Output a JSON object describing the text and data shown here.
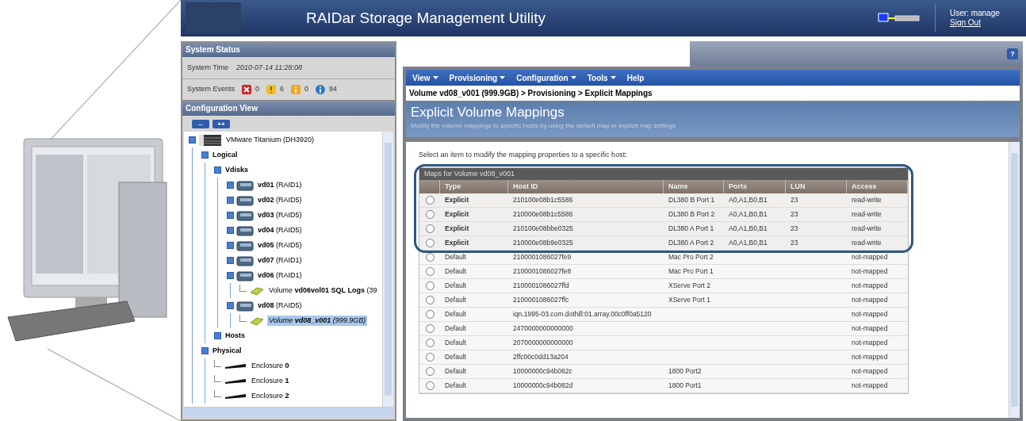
{
  "header": {
    "title": "RAIDar Storage Management Utility",
    "user": "User: manage",
    "sign_out": "Sign Out"
  },
  "system_status": {
    "title": "System Status",
    "time_label": "System Time",
    "time_value": "2010-07-14 11:28:08",
    "events_label": "System Events",
    "events": [
      {
        "kind": "critical",
        "count": "0"
      },
      {
        "kind": "error",
        "count": "6"
      },
      {
        "kind": "warning",
        "count": "0"
      },
      {
        "kind": "info",
        "count": "94"
      }
    ]
  },
  "configuration_view": {
    "title": "Configuration View",
    "buttons": [
      "--",
      "++"
    ],
    "tree": [
      {
        "label": "VMware Titanium (DH3920)",
        "kind": "system",
        "selected": false,
        "children": [
          {
            "label": "Logical",
            "kind": "group",
            "selected": false,
            "children": [
              {
                "label": "Vdisks",
                "kind": "group",
                "selected": false,
                "children": [
                  {
                    "label": "**vd01** (RAID1)",
                    "kind": "vdisk",
                    "selected": false
                  },
                  {
                    "label": "**vd02** (RAID5)",
                    "kind": "vdisk",
                    "selected": false
                  },
                  {
                    "label": "**vd03** (RAID5)",
                    "kind": "vdisk",
                    "selected": false
                  },
                  {
                    "label": "**vd04** (RAID5)",
                    "kind": "vdisk",
                    "selected": false
                  },
                  {
                    "label": "**vd05** (RAID5)",
                    "kind": "vdisk",
                    "selected": false
                  },
                  {
                    "label": "**vd07** (RAID1)",
                    "kind": "vdisk",
                    "selected": false
                  },
                  {
                    "label": "**vd06** (RAID1)",
                    "kind": "vdisk",
                    "selected": false,
                    "children": [
                      {
                        "label": "Volume **vd06vol01 SQL Logs** (39",
                        "kind": "volume",
                        "selected": false
                      }
                    ]
                  },
                  {
                    "label": "**vd08** (RAID5)",
                    "kind": "vdisk",
                    "selected": false,
                    "children": [
                      {
                        "label": "Volume **vd08_v001** *(999.9GB)*",
                        "kind": "volume",
                        "selected": true
                      }
                    ]
                  }
                ]
              },
              {
                "label": "Hosts",
                "kind": "group",
                "selected": false
              }
            ]
          },
          {
            "label": "Physical",
            "kind": "group",
            "selected": false,
            "children": [
              {
                "label": "Enclosure **0**",
                "kind": "enclosure",
                "selected": false
              },
              {
                "label": "Enclosure **1**",
                "kind": "enclosure",
                "selected": false
              },
              {
                "label": "Enclosure **2**",
                "kind": "enclosure",
                "selected": false
              }
            ]
          }
        ]
      }
    ]
  },
  "menu": [
    {
      "label": "View",
      "dropdown": true
    },
    {
      "label": "Provisioning",
      "dropdown": true
    },
    {
      "label": "Configuration",
      "dropdown": true
    },
    {
      "label": "Tools",
      "dropdown": true
    },
    {
      "label": "Help",
      "dropdown": false
    }
  ],
  "help_button": "?",
  "breadcrumb": "Volume vd08_v001 (999.9GB) > Provisioning > Explicit Mappings",
  "page": {
    "title": "Explicit Volume Mappings",
    "subtitle": "Modify the volume mappings to specific hosts by using the default map or explicit map settings",
    "instruction": "Select an item to modify the mapping properties to a specific host:"
  },
  "table": {
    "caption": "Maps for Volume vd08_v001",
    "columns": [
      "Type",
      "Host ID",
      "Name",
      "Ports",
      "LUN",
      "Access"
    ],
    "rows": [
      {
        "selected": false,
        "highlighted": true,
        "cells": [
          "Explicit",
          "210100e08b1c5586",
          "DL380 B Port 1",
          "A0,A1,B0,B1",
          "23",
          "read-write"
        ]
      },
      {
        "selected": false,
        "highlighted": true,
        "cells": [
          "Explicit",
          "210000e08b1c5586",
          "DL380 B Port 2",
          "A0,A1,B0,B1",
          "23",
          "read-write"
        ]
      },
      {
        "selected": false,
        "highlighted": true,
        "cells": [
          "Explicit",
          "210100e08bbe0325",
          "DL380 A Port 1",
          "A0,A1,B0,B1",
          "23",
          "read-write"
        ]
      },
      {
        "selected": false,
        "highlighted": true,
        "cells": [
          "Explicit",
          "210000e08b9e0325",
          "DL380 A Port 2",
          "A0,A1,B0,B1",
          "23",
          "read-write"
        ]
      },
      {
        "selected": false,
        "highlighted": false,
        "cells": [
          "Default",
          "2100001086027fe9",
          "Mac Pro Port 2",
          "",
          "",
          "not-mapped"
        ]
      },
      {
        "selected": false,
        "highlighted": false,
        "cells": [
          "Default",
          "2100001086027fe8",
          "Mac Pro Port 1",
          "",
          "",
          "not-mapped"
        ]
      },
      {
        "selected": false,
        "highlighted": false,
        "cells": [
          "Default",
          "2100001086027ffd",
          "XServe Port 2",
          "",
          "",
          "not-mapped"
        ]
      },
      {
        "selected": false,
        "highlighted": false,
        "cells": [
          "Default",
          "2100001086027ffc",
          "XServe Port 1",
          "",
          "",
          "not-mapped"
        ]
      },
      {
        "selected": false,
        "highlighted": false,
        "cells": [
          "Default",
          "iqn.1995-03.com.dothill:01.array.00c0ff0a5120",
          "",
          "",
          "",
          "not-mapped"
        ]
      },
      {
        "selected": false,
        "highlighted": false,
        "cells": [
          "Default",
          "2470000000000000",
          "",
          "",
          "",
          "not-mapped"
        ]
      },
      {
        "selected": false,
        "highlighted": false,
        "cells": [
          "Default",
          "2070000000000000",
          "",
          "",
          "",
          "not-mapped"
        ]
      },
      {
        "selected": false,
        "highlighted": false,
        "cells": [
          "Default",
          "2ffc00c0dd13a204",
          "",
          "",
          "",
          "not-mapped"
        ]
      },
      {
        "selected": false,
        "highlighted": false,
        "cells": [
          "Default",
          "10000000c94b082c",
          "1800 Port2",
          "",
          "",
          "not-mapped"
        ]
      },
      {
        "selected": false,
        "highlighted": false,
        "cells": [
          "Default",
          "10000000c94b082d",
          "1800 Port1",
          "",
          "",
          "not-mapped"
        ]
      }
    ]
  }
}
